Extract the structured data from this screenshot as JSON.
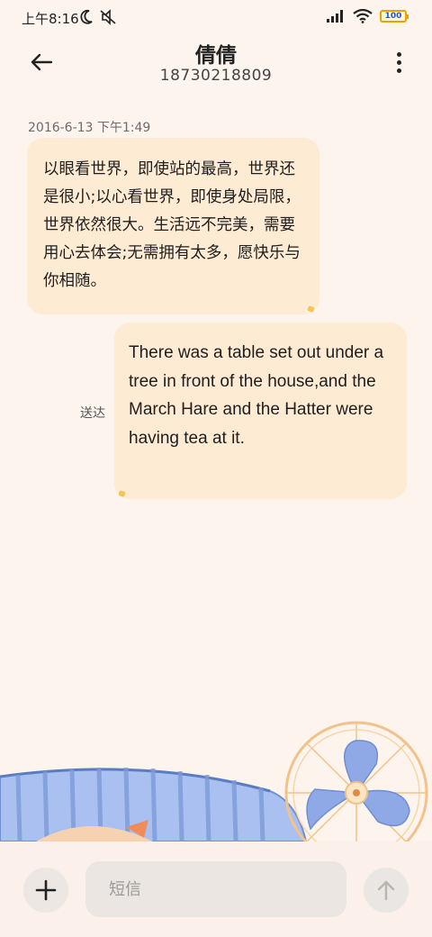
{
  "status_bar": {
    "time": "上午8:16",
    "icons": [
      "moon-icon",
      "mute-icon",
      "signal-icon",
      "wifi-icon",
      "battery-icon"
    ],
    "battery_level": "100"
  },
  "header": {
    "title": "倩倩",
    "phone": "18730218809"
  },
  "conversation": {
    "timestamp": "2016-6-13 下午1:49",
    "messages": [
      {
        "direction": "incoming",
        "text": "以眼看世界，即使站的最高，世界还是很小;以心看世界，即使身处局限，世界依然很大。生活远不完美，需要用心去体会;无需拥有太多，愿快乐与你相随。"
      },
      {
        "direction": "outgoing",
        "text": "There was a table set out under a tree in front of the house,and the March Hare and the Hatter were having tea at it.",
        "status": "送达"
      }
    ]
  },
  "composer": {
    "placeholder": "短信"
  },
  "colors": {
    "background": "#fdf4ee",
    "bubble": "#fdebd3",
    "accent_dot": "#f3c65c"
  }
}
